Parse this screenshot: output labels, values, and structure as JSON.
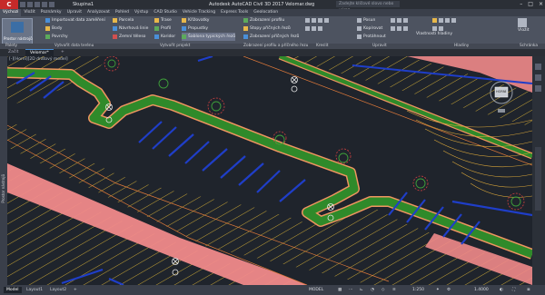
{
  "app": {
    "title": "Autodesk AutoCAD Civil 3D 2017  Velomar.dwg",
    "file": "Skupina1",
    "search_placeholder": "Zadejte klíčové slovo nebo výraz"
  },
  "ribbon_tabs": [
    "Výchozí",
    "Vložit",
    "Poznámky",
    "Upravit",
    "Analyzovat",
    "Pohled",
    "Výstup",
    "CAD Studio",
    "Vehicle Tracking",
    "Express Tools",
    "Geolocation"
  ],
  "ribbon": {
    "big_button": "Prostor nástrojů",
    "col1": [
      "Importovat data zaměření",
      "Body",
      "Povrchy"
    ],
    "col2": [
      "Parcela",
      "Návrhová linie",
      "Zemní těleso"
    ],
    "col3": [
      "Trase",
      "Profil",
      "Koridor"
    ],
    "col4": [
      "Křižovatky",
      "Propustky",
      "Šablona typických řezů"
    ],
    "col5": [
      "Zobrazení profilu",
      "Stopy příčných řezů",
      "Zobrazení příčných řezů"
    ],
    "col6_label": "Kreslit",
    "col7": [
      "Posun",
      "Kopírovat",
      "Protáhnout"
    ],
    "col8_label": "Upravit",
    "col9_label": "Vlastnosti hladiny",
    "col10_label": "Vložit",
    "panels": [
      "Palety",
      "Vytvořit data terénu",
      "Vytvořit projekt",
      "Zobrazení profilu a příčného řezu",
      "Kreslit",
      "Upravit",
      "Hladiny",
      "Schránka"
    ]
  },
  "doc_tabs": [
    "Začít",
    "Velomar*"
  ],
  "viewport_label": "[-][Horní][2D drátový model]",
  "side_palette": "Prostor nástrojů",
  "navcube_label": "HORNÍ",
  "status": {
    "tabs": [
      "Model",
      "Layout1",
      "Layout2"
    ],
    "model_label": "MODEL",
    "scale": "1:250",
    "zoom": "1.4000"
  },
  "colors": {
    "canvas": "#1f242c",
    "road_green": "#2f8a2a",
    "hatch_yellow": "#d8b236",
    "boundary_blue": "#1f3ec8",
    "pink_zone": "#f08a8a",
    "contour_orange": "#d9a63a"
  }
}
